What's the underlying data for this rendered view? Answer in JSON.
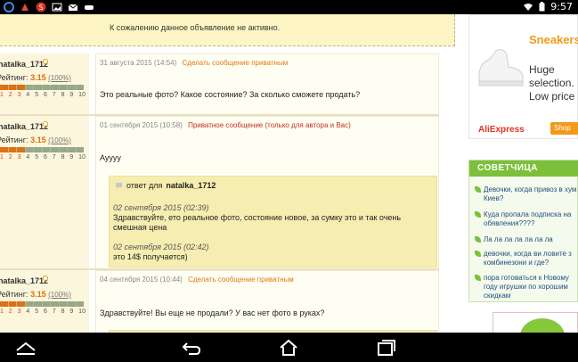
{
  "status_bar": {
    "time": "9:57",
    "left_icons": [
      "s-app-icon",
      "paint-icon",
      "s-logo-icon",
      "image-icon",
      "mail-icon",
      "gamepad-icon"
    ],
    "right_icons": [
      "wifi-icon",
      "battery-icon"
    ]
  },
  "notice": {
    "text": "К сожалению данное объявление не активно."
  },
  "posts": [
    {
      "author": "natalka_1712",
      "rating_label": "Рейтинг:",
      "rating_value": "3.15",
      "rating_percent": "(100%)",
      "date": "31 августа 2015 (14:54)",
      "action": "Сделать сообщение приватным",
      "text": "Это реальные фото? Какое состояние? За сколько сможете продать?"
    },
    {
      "author": "natalka_1712",
      "rating_label": "Рейтинг:",
      "rating_value": "3.15",
      "rating_percent": "(100%)",
      "date": "01 сентября 2015 (10:58)",
      "action": "Приватное сообщение (только для автора и Вас)",
      "text": "Ауууу",
      "reply": {
        "prefix": "ответ для",
        "to": "natalka_1712",
        "entries": [
          {
            "date": "02 сентября 2015 (02:39)",
            "text": "Здравствуйте, ето реальное фото, состояние новое, за сумку это и так очень смешная цена"
          },
          {
            "date": "02 сентября 2015 (02:42)",
            "text": "это 14$ получается)"
          }
        ]
      }
    },
    {
      "author": "natalka_1712",
      "rating_label": "Рейтинг:",
      "rating_value": "3.15",
      "rating_percent": "(100%)",
      "date": "04 сентября 2015 (10:44)",
      "action": "Сделать сообщение приватным",
      "text": "Здравствуйте! Вы еще не продали? У вас нет фото в руках?"
    }
  ],
  "rating_scale": {
    "numbers": [
      "1",
      "2",
      "3",
      "4",
      "5",
      "6",
      "7",
      "8",
      "9",
      "10"
    ],
    "level": 3
  },
  "ad": {
    "brand": "Sneakers",
    "line1": "Huge",
    "line2": "selection.",
    "line3": "Low price",
    "logo": "AliExpress",
    "button": "Shop"
  },
  "advice": {
    "title": "СОВЕТЧИЦА",
    "items": [
      "Девочки, когда привоз в хум Киев?",
      "Куда пропала подписка на обявления????",
      "Ла ла ла ла ла ла ла",
      "девочки, когда ви ловите з комбинезони и где?",
      "пора готоваться к Новому году игрушки по хорошим скидкам"
    ]
  },
  "colors": {
    "notice_bg": "#fdf6c4",
    "accent_orange": "#e07a10",
    "private_red": "#c03020",
    "advice_green": "#7cbf3a"
  }
}
